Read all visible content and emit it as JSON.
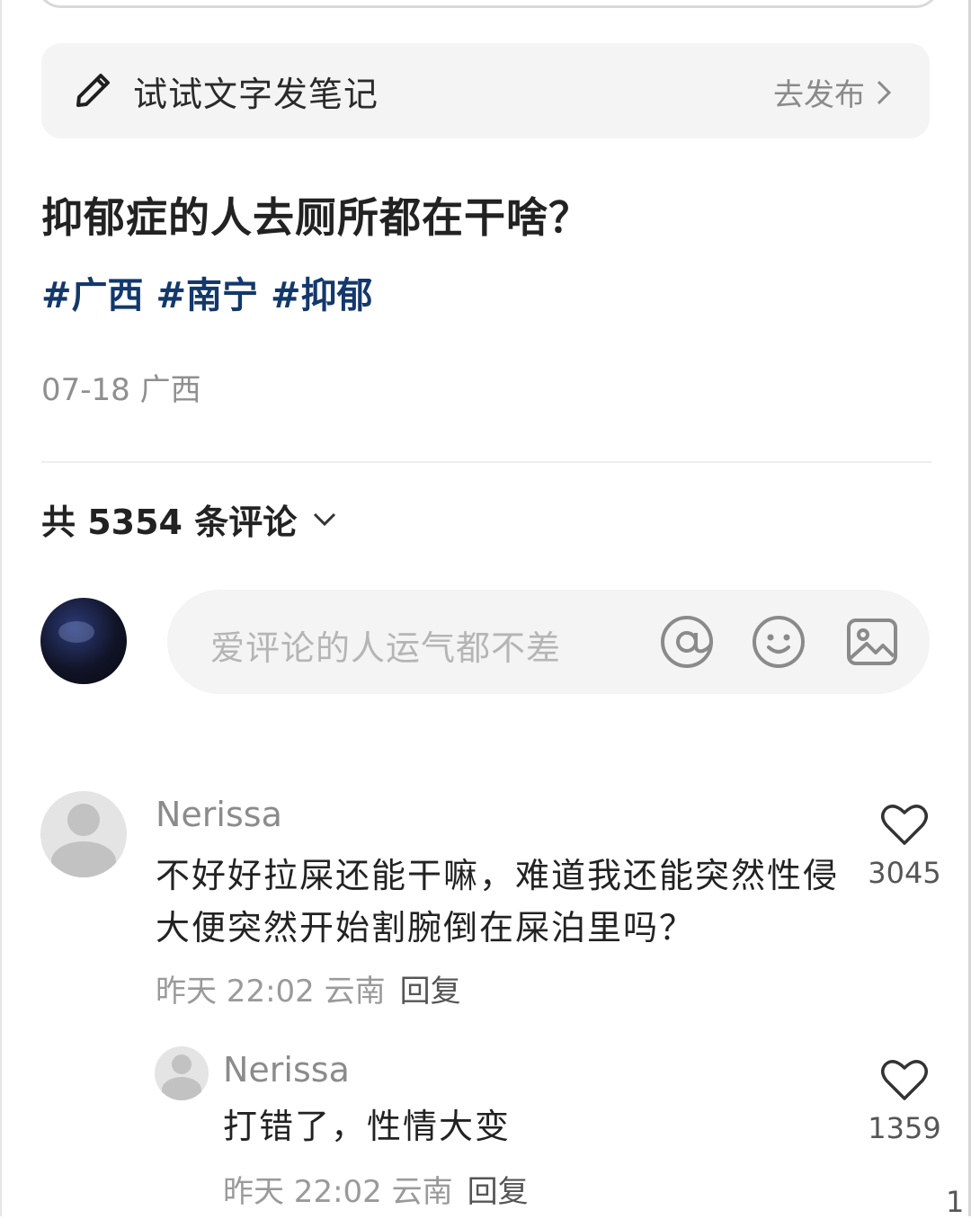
{
  "note_prompt": {
    "text": "试试文字发笔记",
    "action": "去发布"
  },
  "post": {
    "title": "抑郁症的人去厕所都在干啥？",
    "tags": [
      "#广西",
      "#南宁",
      "#抑郁"
    ],
    "date": "07-18",
    "location": "广西"
  },
  "comments_header": {
    "label": "共 5354 条评论"
  },
  "comment_input": {
    "placeholder": "爱评论的人运气都不差"
  },
  "comments": [
    {
      "name": "Nerissa",
      "text": "不好好拉屎还能干嘛，难道我还能突然性侵大便突然开始割腕倒在屎泊里吗？",
      "time": "昨天 22:02",
      "location": "云南",
      "reply_label": "回复",
      "likes": "3045"
    },
    {
      "name": "Nerissa",
      "text": "打错了，性情大变",
      "time": "昨天 22:02",
      "location": "云南",
      "reply_label": "回复",
      "likes": "1359"
    }
  ],
  "corner_fragment": "1",
  "colors": {
    "tag": "#13386b",
    "background": "#ffffff",
    "panel": "#f4f4f4"
  },
  "icons": [
    "pencil-icon",
    "chevron-right-icon",
    "chevron-down-icon",
    "at-icon",
    "emoji-icon",
    "image-icon",
    "heart-icon"
  ]
}
